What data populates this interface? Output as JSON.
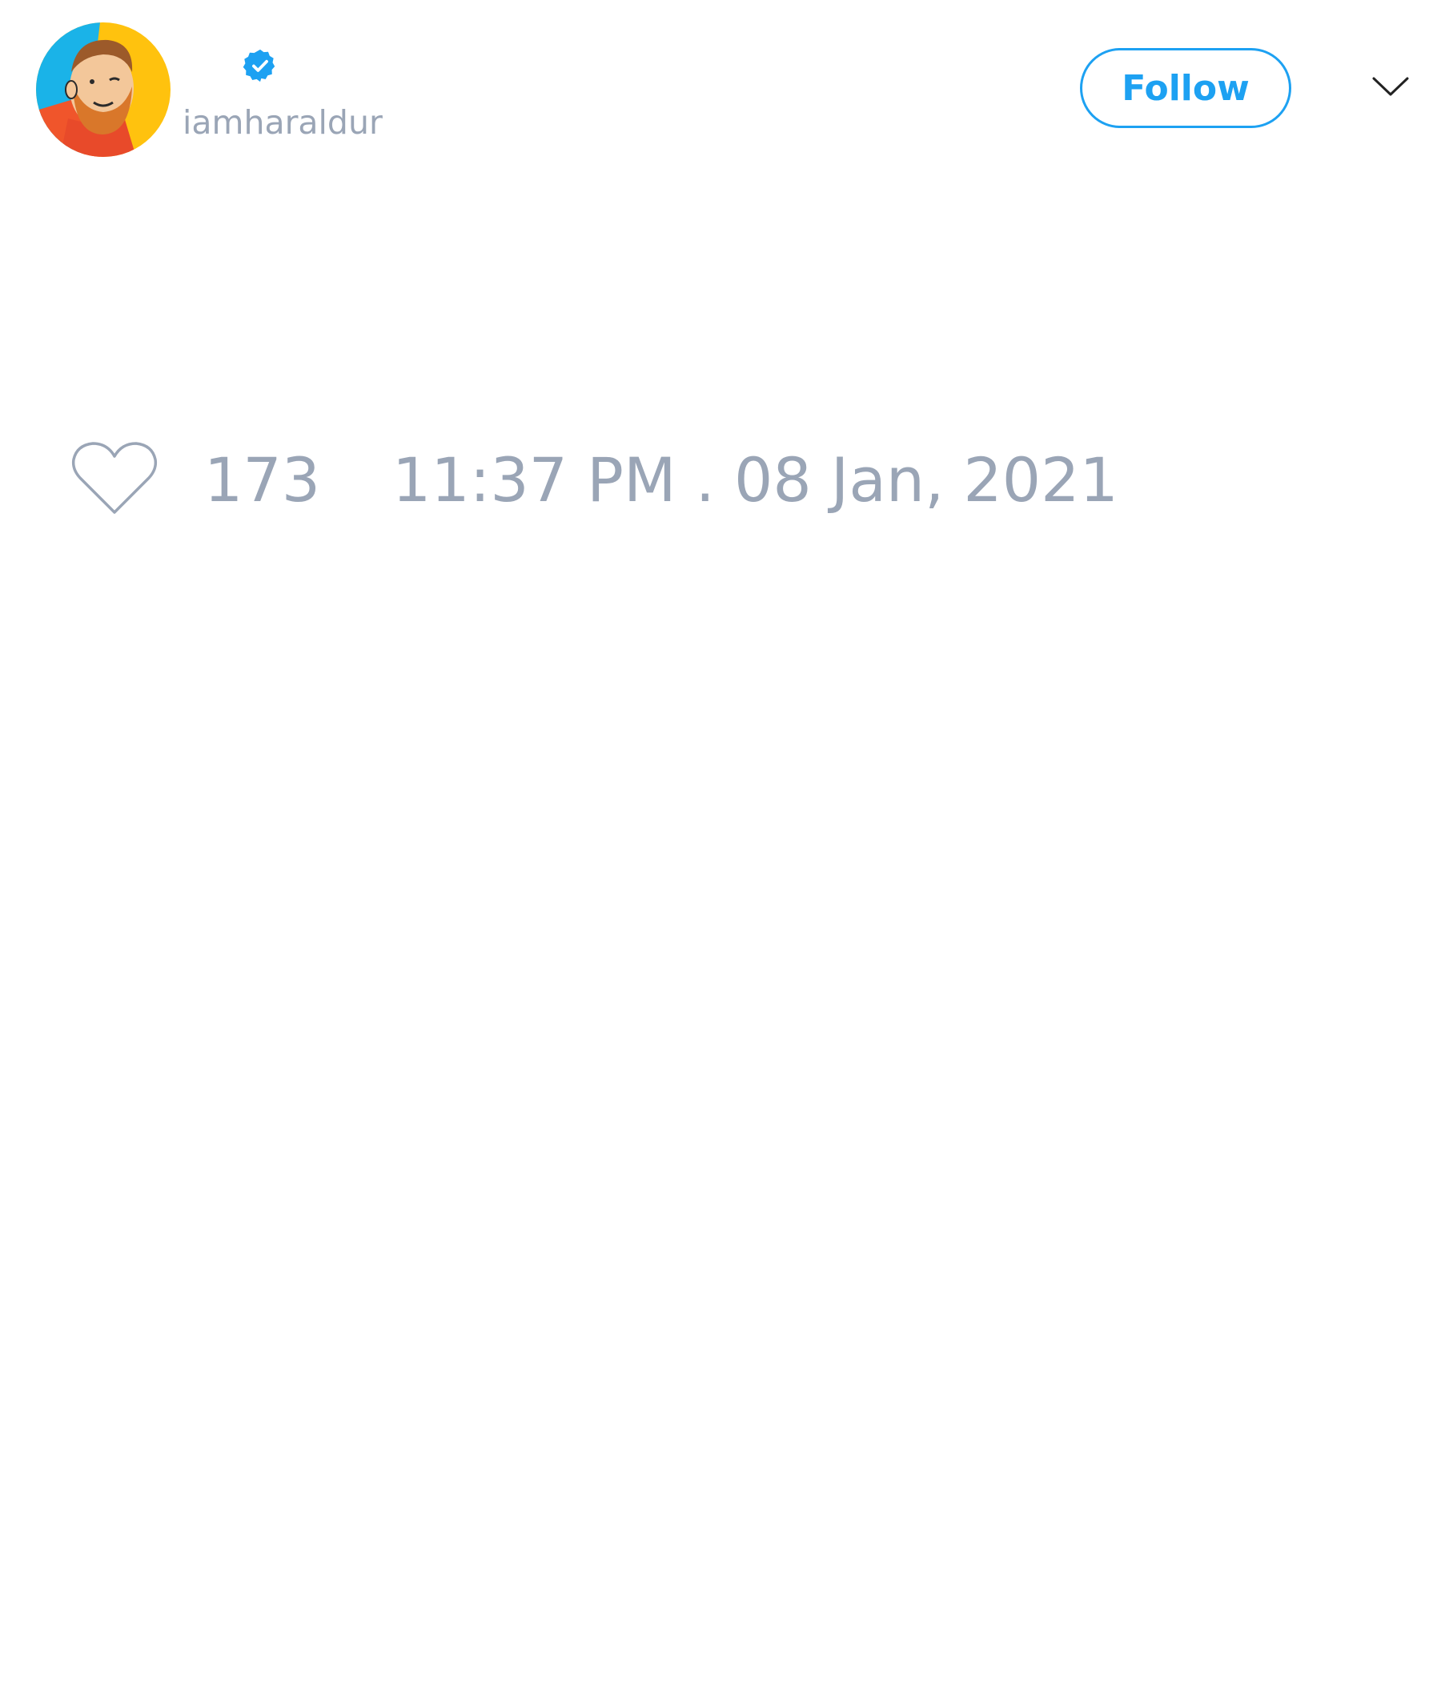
{
  "tweet": {
    "author": {
      "username": "iamharaldur",
      "verified": true,
      "avatar_icon": "bearded-man-cartoon-avatar"
    },
    "follow_button_label": "Follow",
    "menu_icon": "chevron-down-icon",
    "likes": {
      "icon": "heart-outline-icon",
      "count": "173"
    },
    "timestamp": "11:37 PM . 08 Jan, 2021"
  },
  "colors": {
    "accent": "#1da1f2",
    "muted_text": "#9aa5b6",
    "background": "#ffffff"
  }
}
